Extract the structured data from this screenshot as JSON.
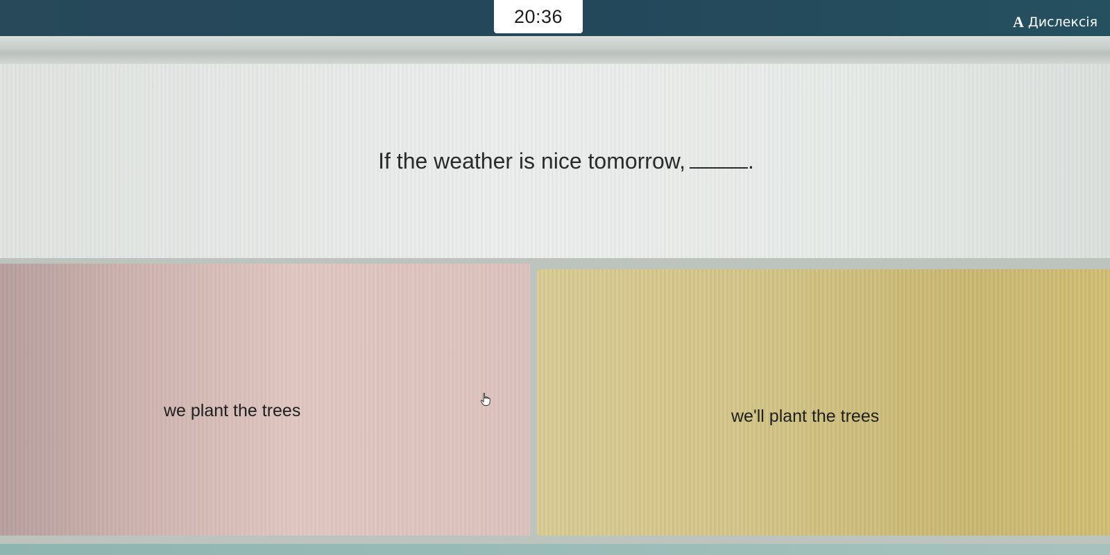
{
  "header": {
    "timer": "20:36",
    "dyslexia": {
      "icon": "A",
      "label": "Дислексія"
    }
  },
  "question": {
    "text": "If the weather is nice tomorrow,",
    "end_punctuation": "."
  },
  "answers": [
    {
      "label": "we plant the trees",
      "color": "#dcc2bd"
    },
    {
      "label": "we'll plant the trees",
      "color": "#d3c486"
    }
  ],
  "colors": {
    "topbar": "#23475a",
    "timer_bg": "#ffffff"
  }
}
